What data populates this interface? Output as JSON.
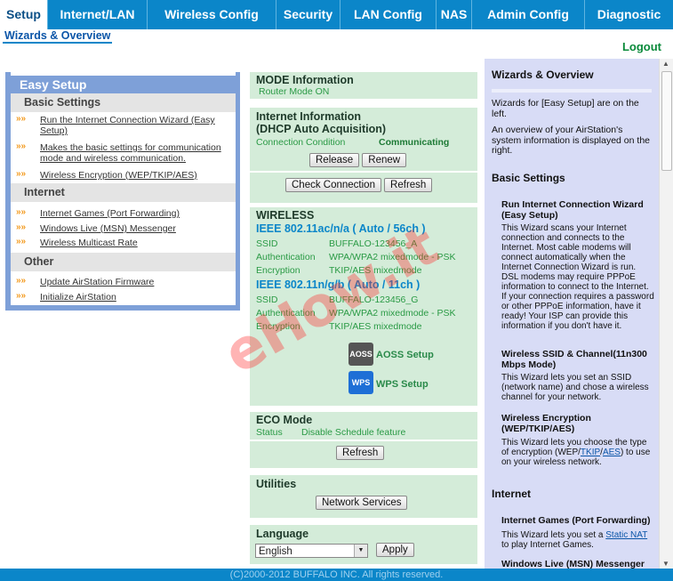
{
  "nav": {
    "tabs": [
      "Setup",
      "Internet/LAN",
      "Wireless Config",
      "Security",
      "LAN Config",
      "NAS",
      "Admin Config",
      "Diagnostic"
    ],
    "subtab": "Wizards & Overview",
    "logout": "Logout"
  },
  "easy_setup": {
    "title": "Easy Setup",
    "groups": [
      {
        "label": "Basic Settings",
        "items": [
          "Run the Internet Connection Wizard (Easy Setup)",
          "Makes the basic settings for communication mode and wireless communication.",
          "Wireless Encryption (WEP/TKIP/AES)"
        ]
      },
      {
        "label": "Internet",
        "items": [
          "Internet Games (Port Forwarding)",
          "Windows Live (MSN) Messenger",
          "Wireless Multicast Rate"
        ]
      },
      {
        "label": "Other",
        "items": [
          "Update AirStation Firmware",
          "Initialize AirStation"
        ]
      }
    ]
  },
  "mode": {
    "title": "MODE Information",
    "value": "Router Mode ON"
  },
  "internet": {
    "title": "Internet Information",
    "subtitle": "(DHCP Auto Acquisition)",
    "cond_label": "Connection Condition",
    "cond_value": "Communicating",
    "release": "Release",
    "renew": "Renew",
    "check": "Check Connection",
    "refresh": "Refresh"
  },
  "wireless": {
    "title": "WIRELESS",
    "bands": [
      {
        "name": "IEEE 802.11ac/n/a ( Auto / 56ch )",
        "rows": [
          [
            "SSID",
            "BUFFALO-123456_A"
          ],
          [
            "Authentication",
            "WPA/WPA2 mixedmode - PSK"
          ],
          [
            "Encryption",
            "TKIP/AES mixedmode"
          ]
        ]
      },
      {
        "name": "IEEE 802.11n/g/b ( Auto / 11ch )",
        "rows": [
          [
            "SSID",
            "BUFFALO-123456_G"
          ],
          [
            "Authentication",
            "WPA/WPA2 mixedmode - PSK"
          ],
          [
            "Encryption",
            "TKIP/AES mixedmode"
          ]
        ]
      }
    ],
    "aoss": "AOSS Setup",
    "aoss_icon_text": "AOSS",
    "wps": "WPS Setup",
    "wps_icon_text": "WPS"
  },
  "eco": {
    "title": "ECO Mode",
    "status_label": "Status",
    "status_value": "Disable Schedule feature",
    "refresh": "Refresh"
  },
  "utilities": {
    "title": "Utilities",
    "button": "Network Services"
  },
  "language": {
    "title": "Language",
    "selected": "English",
    "apply": "Apply"
  },
  "help": {
    "title": "Wizards & Overview",
    "intro1": "Wizards for [Easy Setup] are on the left.",
    "intro2": "An overview of your AirStation's system information is displayed on the right.",
    "basic": "Basic Settings",
    "run_title": "Run Internet Connection Wizard (Easy Setup)",
    "run_text": "This Wizard scans your Internet connection and connects to the Internet. Most cable modems will connect automatically when the Internet Connection Wizard is run. DSL modems may require PPPoE information to connect to the Internet. If your connection requires a password or other PPPoE information, have it ready! Your ISP can provide this information if you don't have it.",
    "ssid_title": "Wireless SSID & Channel(11n300 Mbps Mode)",
    "ssid_text": "This Wizard lets you set an SSID (network name) and chose a wireless channel for your network.",
    "enc_title": "Wireless Encryption (WEP/TKIP/AES)",
    "enc_text_a": "This Wizard lets you choose the type of encryption (WEP/",
    "enc_link1": "TKIP",
    "enc_text_b": "/",
    "enc_link2": "AES",
    "enc_text_c": ") to use on your wireless network.",
    "internet": "Internet",
    "games_title": "Internet Games (Port Forwarding)",
    "games_text_a": "This Wizard lets you set a ",
    "games_link": "Static NAT",
    "games_text_b": " to play Internet Games.",
    "msn_title": "Windows Live (MSN) Messenger"
  },
  "footer": "(C)2000-2012 BUFFALO INC. All rights reserved.",
  "watermark": "eHow.it"
}
